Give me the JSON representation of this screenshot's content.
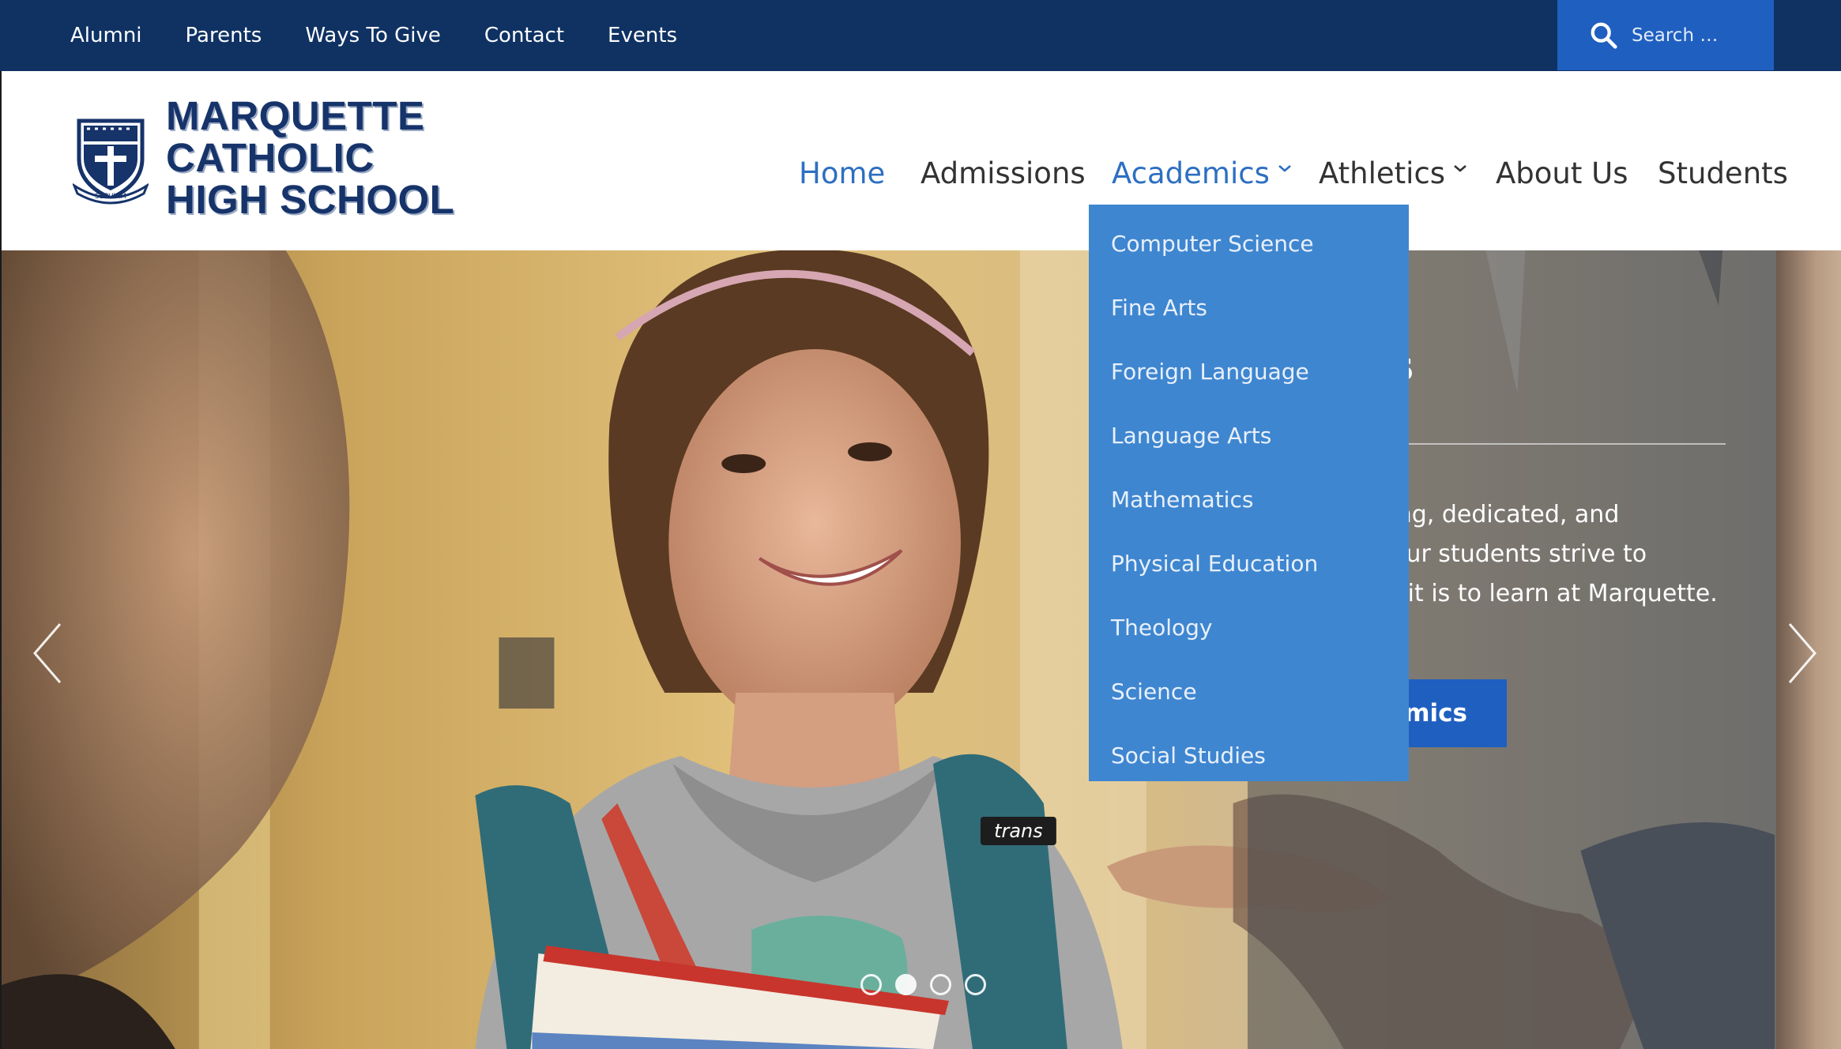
{
  "utility_nav": {
    "links": [
      "Alumni",
      "Parents",
      "Ways To Give",
      "Contact",
      "Events"
    ]
  },
  "search": {
    "placeholder": "Search …",
    "icon": "search-icon"
  },
  "logo": {
    "lines": [
      "MARQUETTE",
      "CATHOLIC",
      "HIGH SCHOOL"
    ],
    "crest_motto": "SERVIAM"
  },
  "main_nav": {
    "items": [
      {
        "label": "Home",
        "active": true,
        "has_dropdown": false
      },
      {
        "label": "Admissions",
        "active": false,
        "has_dropdown": false
      },
      {
        "label": "Academics",
        "active": true,
        "has_dropdown": true
      },
      {
        "label": "Athletics",
        "active": false,
        "has_dropdown": true
      },
      {
        "label": "About Us",
        "active": false,
        "has_dropdown": false
      },
      {
        "label": "Students",
        "active": false,
        "has_dropdown": false
      }
    ]
  },
  "academics_dropdown": {
    "items": [
      "Computer Science",
      "Fine Arts",
      "Foreign Language",
      "Language Arts",
      "Mathematics",
      "Physical Education",
      "Theology",
      "Science",
      "Social Studies"
    ]
  },
  "hero": {
    "heading_visible": "nts",
    "body_lines": [
      "king, dedicated, and",
      ", our students strive to",
      "at it is to learn at Marquette."
    ],
    "button_visible": "mics",
    "slide_count": 4,
    "active_slide": 2
  },
  "colors": {
    "utility_bar": "#0f3263",
    "search_bg": "#1f5fc0",
    "nav_active": "#2d6fc2",
    "dropdown_bg": "#3f86d0",
    "logo_text": "#16336a"
  }
}
